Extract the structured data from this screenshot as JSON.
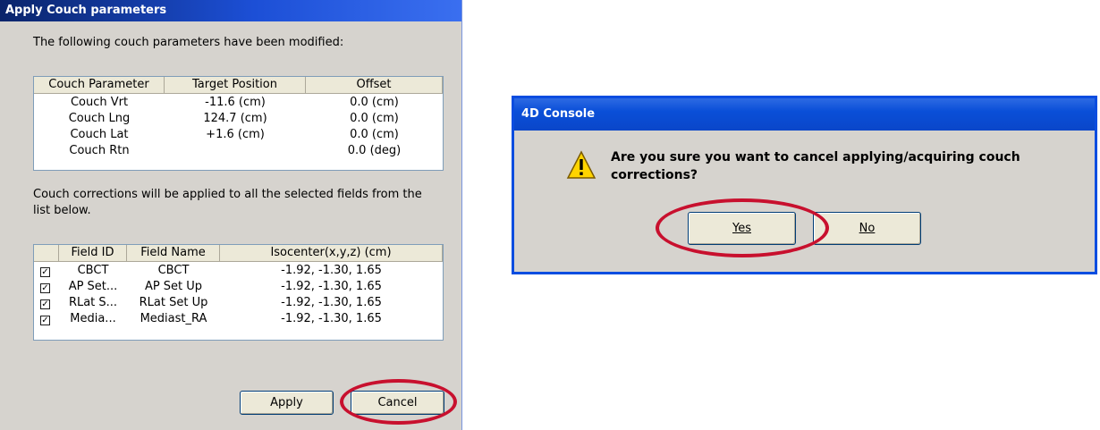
{
  "apply_dialog": {
    "title": "Apply Couch parameters",
    "intro": "The following couch parameters have been modified:",
    "params_headers": [
      "Couch Parameter",
      "Target Position",
      "Offset"
    ],
    "params_rows": [
      [
        "Couch Vrt",
        "-11.6 (cm)",
        "0.0 (cm)"
      ],
      [
        "Couch Lng",
        "124.7 (cm)",
        "0.0 (cm)"
      ],
      [
        "Couch Lat",
        "+1.6 (cm)",
        "0.0 (cm)"
      ],
      [
        "Couch Rtn",
        "",
        "0.0 (deg)"
      ]
    ],
    "note_line1": "Couch corrections will be applied to all the selected fields from the",
    "note_line2": "list below.",
    "fields_headers": [
      "Field ID",
      "Field Name",
      "Isocenter(x,y,z) (cm)"
    ],
    "fields_rows": [
      {
        "checked": true,
        "id": "CBCT",
        "name": "CBCT",
        "iso": "-1.92, -1.30, 1.65"
      },
      {
        "checked": true,
        "id": "AP Set...",
        "name": "AP Set Up",
        "iso": "-1.92, -1.30, 1.65"
      },
      {
        "checked": true,
        "id": "RLat S...",
        "name": "RLat Set Up",
        "iso": "-1.92, -1.30, 1.65"
      },
      {
        "checked": true,
        "id": "Media...",
        "name": "Mediast_RA",
        "iso": "-1.92, -1.30, 1.65"
      }
    ],
    "apply_label": "Apply",
    "cancel_label": "Cancel"
  },
  "confirm_dialog": {
    "title": "4D Console",
    "message_line1": "Are you sure you want to cancel applying/acquiring couch",
    "message_line2": "corrections?",
    "yes_label": "Yes",
    "no_label": "No",
    "icon": "warning-icon"
  },
  "colors": {
    "highlight_ring": "#c8102e",
    "dialog_bg": "#d6d3ce",
    "titlebar": "#0a46c9"
  }
}
